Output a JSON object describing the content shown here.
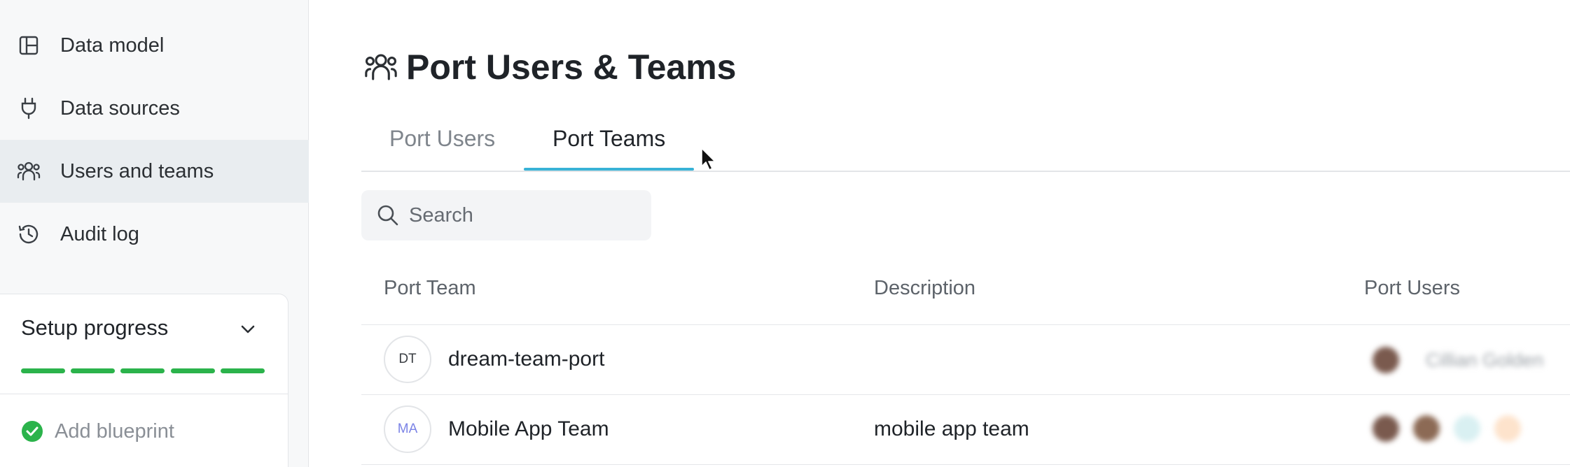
{
  "sidebar": {
    "items": [
      {
        "label": "Data model",
        "icon": "layout-icon"
      },
      {
        "label": "Data sources",
        "icon": "plug-icon"
      },
      {
        "label": "Users and teams",
        "icon": "users-icon",
        "active": true
      },
      {
        "label": "Audit log",
        "icon": "history-icon"
      }
    ],
    "setup": {
      "title": "Setup progress",
      "progress_segments_completed": 5,
      "progress_segments_total": 5,
      "step_label": "Add blueprint",
      "step_done": true
    }
  },
  "page": {
    "title": "Port Users & Teams",
    "tabs": [
      {
        "label": "Port Users",
        "active": false
      },
      {
        "label": "Port Teams",
        "active": true
      }
    ],
    "search": {
      "placeholder": "Search"
    }
  },
  "table": {
    "columns": [
      "Port Team",
      "Description",
      "Port Users"
    ],
    "rows": [
      {
        "initials": "DT",
        "initials_color": "#3b3f44",
        "name": "dream-team-port",
        "description": "",
        "users_label": "Cillian Golden"
      },
      {
        "initials": "MA",
        "initials_color": "#7b83e6",
        "name": "Mobile App Team",
        "description": "mobile app team",
        "users_label": ""
      }
    ]
  },
  "colors": {
    "accent_tab": "#38b2d6",
    "progress": "#2bb34b",
    "sidebar_bg": "#f7f8f9",
    "active_item_bg": "#e9edf0"
  }
}
